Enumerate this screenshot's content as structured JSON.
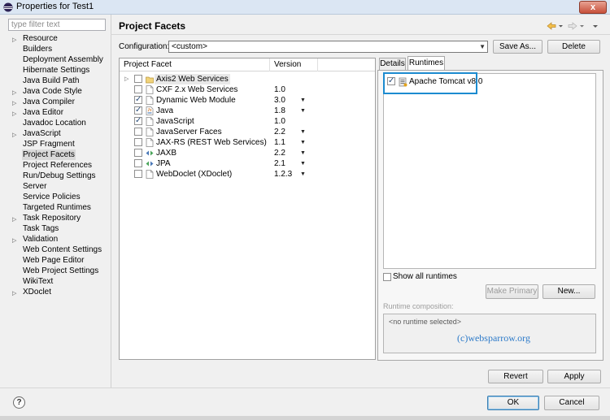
{
  "window": {
    "title": "Properties for Test1",
    "close_label": "x"
  },
  "filter": {
    "placeholder": "type filter text"
  },
  "nav": {
    "items": [
      {
        "label": "Resource",
        "expandable": true
      },
      {
        "label": "Builders",
        "expandable": false
      },
      {
        "label": "Deployment Assembly",
        "expandable": false
      },
      {
        "label": "Hibernate Settings",
        "expandable": false
      },
      {
        "label": "Java Build Path",
        "expandable": false
      },
      {
        "label": "Java Code Style",
        "expandable": true
      },
      {
        "label": "Java Compiler",
        "expandable": true
      },
      {
        "label": "Java Editor",
        "expandable": true
      },
      {
        "label": "Javadoc Location",
        "expandable": false
      },
      {
        "label": "JavaScript",
        "expandable": true
      },
      {
        "label": "JSP Fragment",
        "expandable": false
      },
      {
        "label": "Project Facets",
        "expandable": false,
        "selected": true
      },
      {
        "label": "Project References",
        "expandable": false
      },
      {
        "label": "Run/Debug Settings",
        "expandable": false
      },
      {
        "label": "Server",
        "expandable": false
      },
      {
        "label": "Service Policies",
        "expandable": false
      },
      {
        "label": "Targeted Runtimes",
        "expandable": false
      },
      {
        "label": "Task Repository",
        "expandable": true
      },
      {
        "label": "Task Tags",
        "expandable": false
      },
      {
        "label": "Validation",
        "expandable": true
      },
      {
        "label": "Web Content Settings",
        "expandable": false
      },
      {
        "label": "Web Page Editor",
        "expandable": false
      },
      {
        "label": "Web Project Settings",
        "expandable": false
      },
      {
        "label": "WikiText",
        "expandable": false
      },
      {
        "label": "XDoclet",
        "expandable": true
      }
    ]
  },
  "header": {
    "title": "Project Facets"
  },
  "configuration": {
    "label": "Configuration:",
    "value": "<custom>",
    "save_as": "Save As...",
    "delete": "Delete"
  },
  "facets": {
    "col_facet": "Project Facet",
    "col_version": "Version",
    "rows": [
      {
        "name": "Axis2 Web Services",
        "version": "",
        "checked": false,
        "expandable": true,
        "dropdown": false,
        "icon": "folder-icon",
        "highlight": true
      },
      {
        "name": "CXF 2.x Web Services",
        "version": "1.0",
        "checked": false,
        "expandable": false,
        "dropdown": false,
        "icon": "page-icon"
      },
      {
        "name": "Dynamic Web Module",
        "version": "3.0",
        "checked": true,
        "expandable": false,
        "dropdown": true,
        "icon": "page-icon"
      },
      {
        "name": "Java",
        "version": "1.8",
        "checked": true,
        "expandable": false,
        "dropdown": true,
        "icon": "java-icon"
      },
      {
        "name": "JavaScript",
        "version": "1.0",
        "checked": true,
        "expandable": false,
        "dropdown": false,
        "icon": "page-icon"
      },
      {
        "name": "JavaServer Faces",
        "version": "2.2",
        "checked": false,
        "expandable": false,
        "dropdown": true,
        "icon": "page-icon"
      },
      {
        "name": "JAX-RS (REST Web Services)",
        "version": "1.1",
        "checked": false,
        "expandable": false,
        "dropdown": true,
        "icon": "page-icon"
      },
      {
        "name": "JAXB",
        "version": "2.2",
        "checked": false,
        "expandable": false,
        "dropdown": true,
        "icon": "jaxb-icon"
      },
      {
        "name": "JPA",
        "version": "2.1",
        "checked": false,
        "expandable": false,
        "dropdown": true,
        "icon": "jpa-icon"
      },
      {
        "name": "WebDoclet (XDoclet)",
        "version": "1.2.3",
        "checked": false,
        "expandable": false,
        "dropdown": true,
        "icon": "page-icon"
      }
    ]
  },
  "tabs": {
    "details": "Details",
    "runtimes": "Runtimes"
  },
  "runtimes": {
    "items": [
      {
        "label": "Apache Tomcat v8.0",
        "checked": true
      }
    ],
    "show_all": "Show all runtimes",
    "make_primary": "Make Primary",
    "new": "New...",
    "composition_label": "Runtime composition:",
    "no_runtime": "<no runtime selected>",
    "watermark": "(c)websparrow.org"
  },
  "buttons": {
    "revert": "Revert",
    "apply": "Apply",
    "ok": "OK",
    "cancel": "Cancel",
    "help": "?"
  },
  "colors": {
    "highlight_border": "#1c8bd0",
    "watermark": "#2e7bc9"
  }
}
